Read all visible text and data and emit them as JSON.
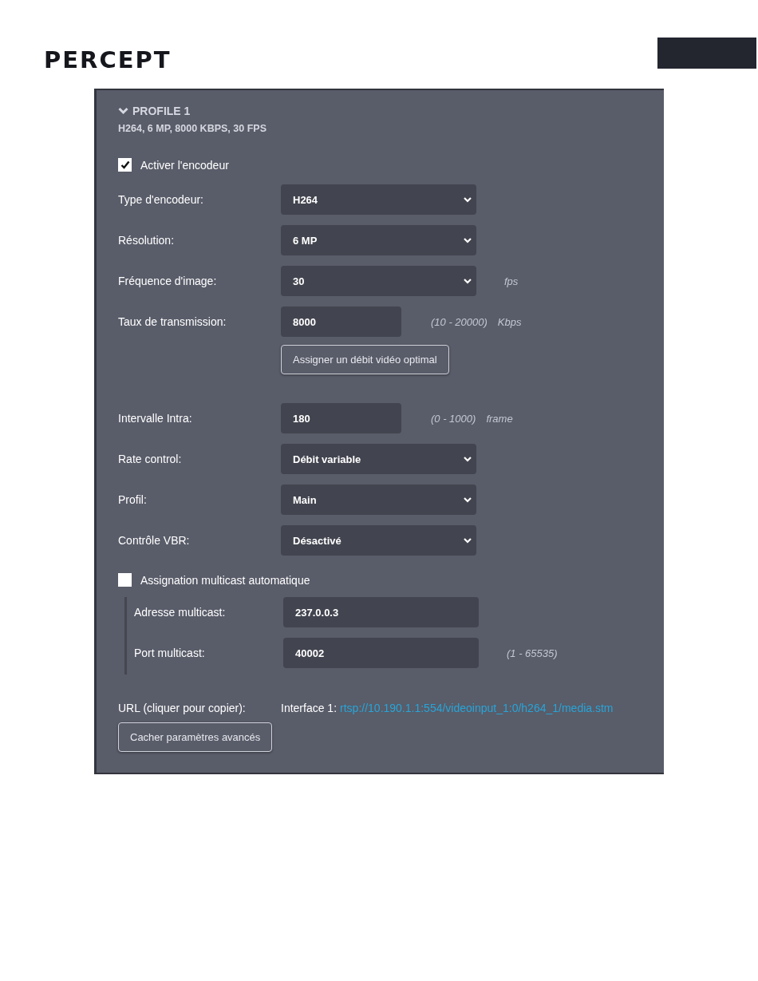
{
  "logo": {
    "text": "PERCEPT"
  },
  "profile": {
    "title": "PROFILE 1",
    "expanded": true,
    "summary": "H264, 6 MP, 8000 KBPS, 30 FPS"
  },
  "encoder": {
    "label": "Activer l'encodeur",
    "checked": true
  },
  "settings": [
    {
      "kind": "select",
      "label": "Type d'encodeur:",
      "value": "H264"
    },
    {
      "kind": "select",
      "label": "Résolution:",
      "value": "6 MP"
    },
    {
      "kind": "select",
      "label": "Fréquence d'image:",
      "value": "30",
      "unit": "fps"
    },
    {
      "kind": "input",
      "label": "Taux de transmission:",
      "value": "8000",
      "range": "(10 - 20000)",
      "unit": "Kbps"
    },
    {
      "kind": "button",
      "label": "Assigner un débit vidéo optimal"
    },
    {
      "kind": "input",
      "label": "Intervalle Intra:",
      "value": "180",
      "range": "(0 - 1000)",
      "unit": "frame"
    },
    {
      "kind": "select",
      "label": "Rate control:",
      "value": "Débit variable"
    },
    {
      "kind": "select",
      "label": "Profil:",
      "value": "Main"
    },
    {
      "kind": "select",
      "label": "Contrôle VBR:",
      "value": "Désactivé"
    }
  ],
  "multicast": {
    "label": "Assignation multicast automatique",
    "checked": false,
    "fields": [
      {
        "label": "Adresse multicast:",
        "value": "237.0.0.3"
      },
      {
        "label": "Port multicast:",
        "value": "40002",
        "range": "(1 - 65535)"
      }
    ]
  },
  "url": {
    "label": "URL (cliquer pour copier):",
    "prefix": "Interface 1:",
    "link": "rtsp://10.190.1.1:554/videoinput_1:0/h264_1/media.stm"
  },
  "advanced_button": "Cacher paramètres avancés"
}
